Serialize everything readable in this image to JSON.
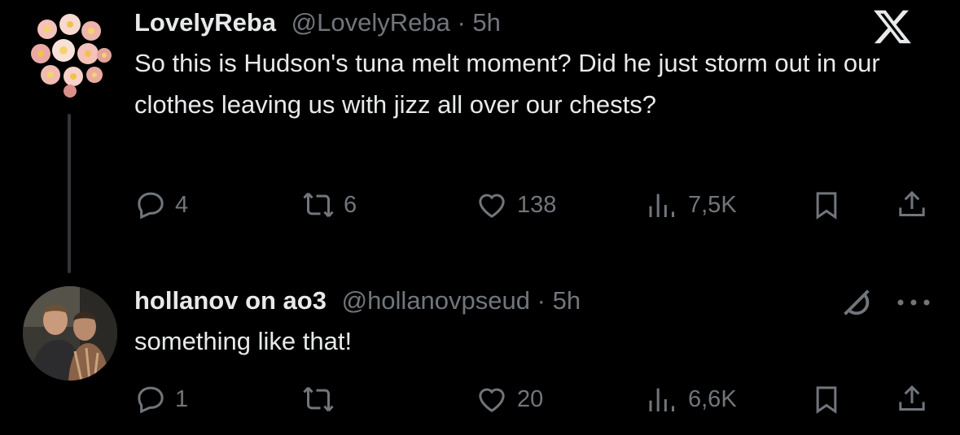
{
  "x_logo_icon": "x-logo-icon",
  "tweets": [
    {
      "name": "LovelyReba",
      "handle": "@LovelyReba",
      "sep": " · ",
      "time": "5h",
      "text": "So this is Hudson's tuna melt moment? Did he just storm out in our clothes leaving us with jizz all over our chests?",
      "stats": {
        "replies": "4",
        "reposts": "6",
        "likes": "138",
        "views": "7,5K"
      }
    },
    {
      "name": "hollanov on ao3",
      "handle": "@hollanovpseud",
      "sep": " · ",
      "time": "5h",
      "text": "something like that!",
      "stats": {
        "replies": "1",
        "reposts": "",
        "likes": "20",
        "views": "6,6K"
      }
    }
  ],
  "colors": {
    "background": "#000000",
    "text": "#e7e9ea",
    "muted": "#71767b",
    "thread_line": "#333639"
  }
}
